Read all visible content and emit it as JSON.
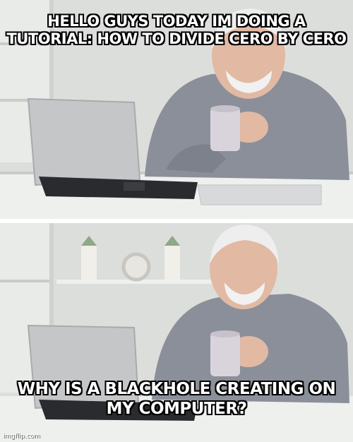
{
  "meme": {
    "top_caption": "HELLO GUYS TODAY IM DOING A TUTORIAL: HOW TO DIVIDE CERO BY CERO",
    "bottom_caption": "WHY IS A BLACKHOLE CREATING ON MY COMPUTER?",
    "watermark": "imgflip.com",
    "colors": {
      "wall": "#dcdedb",
      "shirt": "#8a8f99",
      "skin": "#e2b9a3",
      "laptop": "#c4c6c8",
      "mug": "#d9d4dc",
      "text": "#ffffff",
      "outline": "#000000"
    }
  }
}
